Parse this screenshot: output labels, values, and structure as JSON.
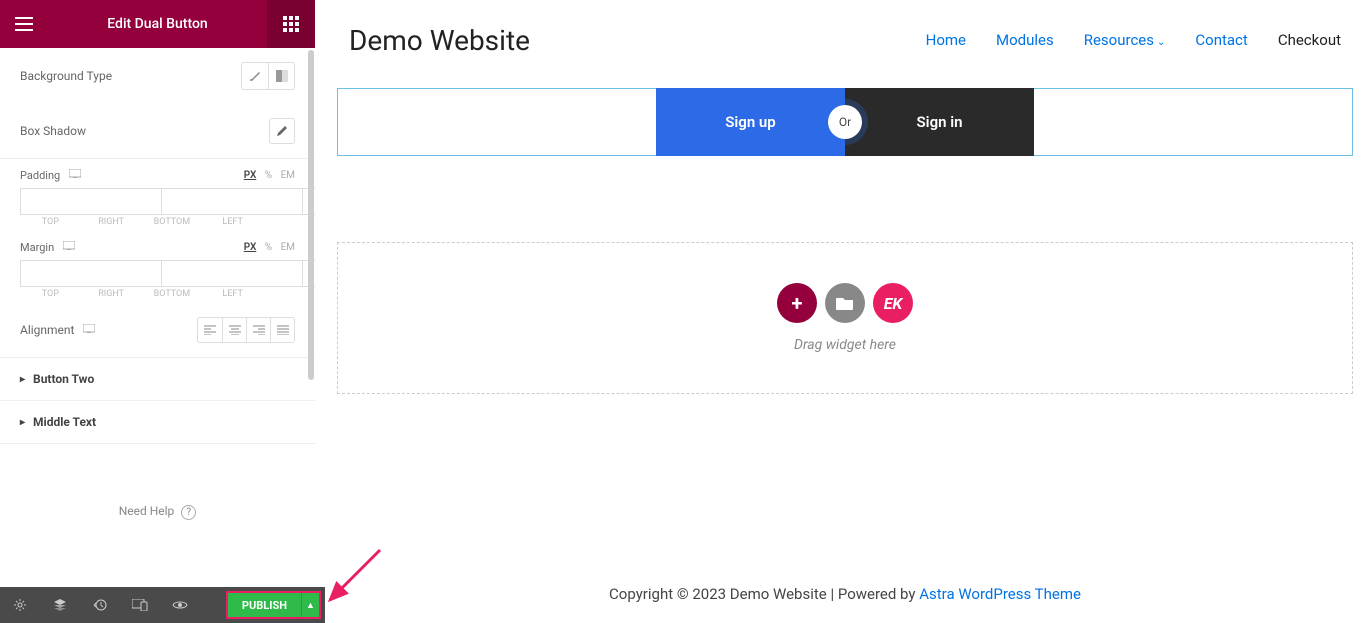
{
  "panel": {
    "title": "Edit Dual Button",
    "bgType": "Background Type",
    "boxShadow": "Box Shadow",
    "padding": "Padding",
    "margin": "Margin",
    "units": {
      "px": "PX",
      "pct": "%",
      "em": "EM"
    },
    "sides": {
      "top": "TOP",
      "right": "RIGHT",
      "bottom": "BOTTOM",
      "left": "LEFT"
    },
    "alignment": "Alignment",
    "accordion": {
      "btn2": "Button Two",
      "middle": "Middle Text"
    },
    "help": "Need Help",
    "publish": "PUBLISH"
  },
  "site": {
    "title": "Demo Website",
    "nav": {
      "home": "Home",
      "modules": "Modules",
      "resources": "Resources",
      "contact": "Contact",
      "checkout": "Checkout"
    }
  },
  "dual": {
    "left": "Sign up",
    "mid": "Or",
    "right": "Sign in"
  },
  "drop": {
    "text": "Drag widget here",
    "ek": "EK"
  },
  "footer": {
    "copy": "Copyright © 2023 Demo Website | Powered by ",
    "theme": "Astra WordPress Theme"
  }
}
